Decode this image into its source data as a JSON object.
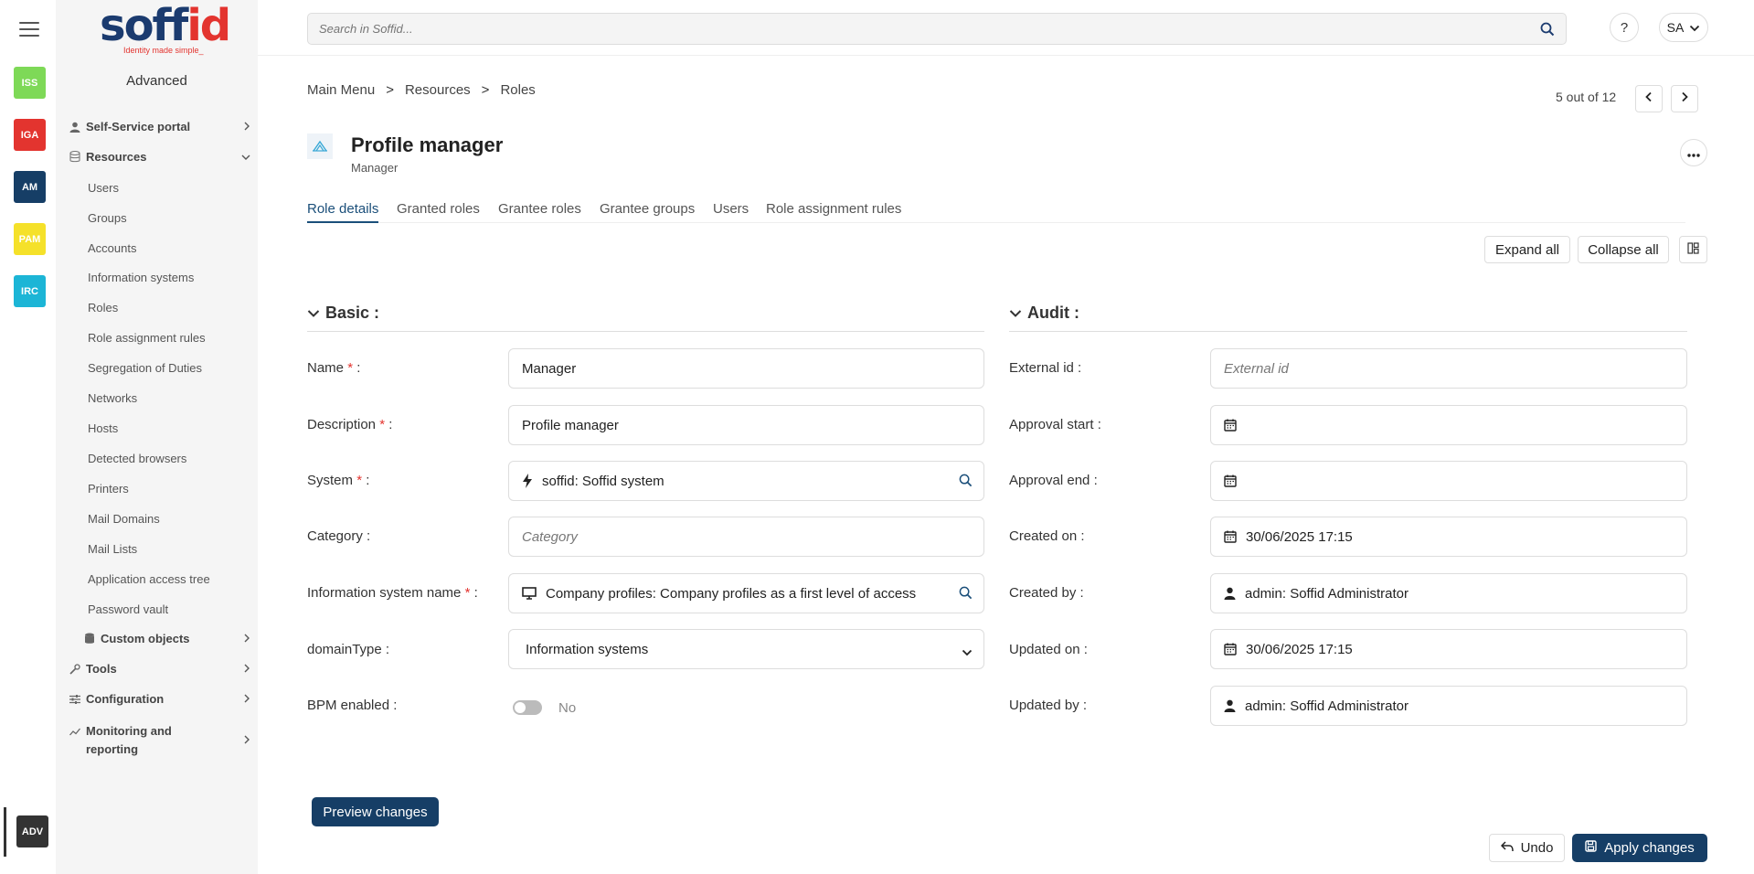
{
  "rail": {
    "apps": [
      {
        "label": "ISS",
        "color": "#7ed957"
      },
      {
        "label": "IGA",
        "color": "#e3342f"
      },
      {
        "label": "AM",
        "color": "#163e66"
      },
      {
        "label": "PAM",
        "color": "#f5e12a"
      },
      {
        "label": "IRC",
        "color": "#1cb5d6"
      }
    ],
    "current_app": {
      "label": "ADV",
      "color": "#333333"
    }
  },
  "logo": {
    "brand_main": "soff",
    "brand_accent": "id",
    "tagline": "Identity made simple_"
  },
  "sidebar": {
    "section": "Advanced",
    "groups": {
      "self_service": "Self-Service portal",
      "resources": "Resources",
      "custom_objects": "Custom objects",
      "tools": "Tools",
      "configuration": "Configuration",
      "monitoring": "Monitoring and reporting"
    },
    "resource_items": [
      "Users",
      "Groups",
      "Accounts",
      "Information systems",
      "Roles",
      "Role assignment rules",
      "Segregation of Duties",
      "Networks",
      "Hosts",
      "Detected browsers",
      "Printers",
      "Mail Domains",
      "Mail Lists",
      "Application access tree",
      "Password vault"
    ]
  },
  "topbar": {
    "search_placeholder": "Search in Soffid...",
    "help": "?",
    "user_initials": "SA"
  },
  "breadcrumb": [
    "Main Menu",
    ">",
    "Resources",
    ">",
    "Roles"
  ],
  "pager": {
    "text": "5 out of 12"
  },
  "role": {
    "title": "Profile manager",
    "subtitle": "Manager"
  },
  "tabs": [
    "Role details",
    "Granted roles",
    "Grantee roles",
    "Grantee groups",
    "Users",
    "Role assignment rules"
  ],
  "actions": {
    "expand_all": "Expand all",
    "collapse_all": "Collapse all"
  },
  "basic": {
    "title": "Basic :",
    "name_label": "Name",
    "name_value": "Manager",
    "description_label": "Description",
    "description_value": "Profile manager",
    "system_label": "System",
    "system_value": "soffid: Soffid system",
    "category_label": "Category :",
    "category_placeholder": "Category",
    "infosys_label": "Information system name",
    "infosys_value": "Company profiles: Company profiles as a first level of access",
    "domain_label": "domainType :",
    "domain_value": "Information systems",
    "bpm_label": "BPM enabled :",
    "bpm_value": "No",
    "required_mark": "*",
    "colon": ":"
  },
  "audit": {
    "title": "Audit :",
    "external_label": "External id :",
    "external_placeholder": "External id",
    "approval_start_label": "Approval start :",
    "approval_end_label": "Approval end :",
    "created_on_label": "Created on :",
    "created_on_value": "30/06/2025 17:15",
    "created_by_label": "Created by :",
    "created_by_value": "admin: Soffid Administrator",
    "updated_on_label": "Updated on :",
    "updated_on_value": "30/06/2025 17:15",
    "updated_by_label": "Updated by :",
    "updated_by_value": "admin: Soffid Administrator"
  },
  "footer": {
    "preview": "Preview changes",
    "undo": "Undo",
    "apply": "Apply changes"
  }
}
